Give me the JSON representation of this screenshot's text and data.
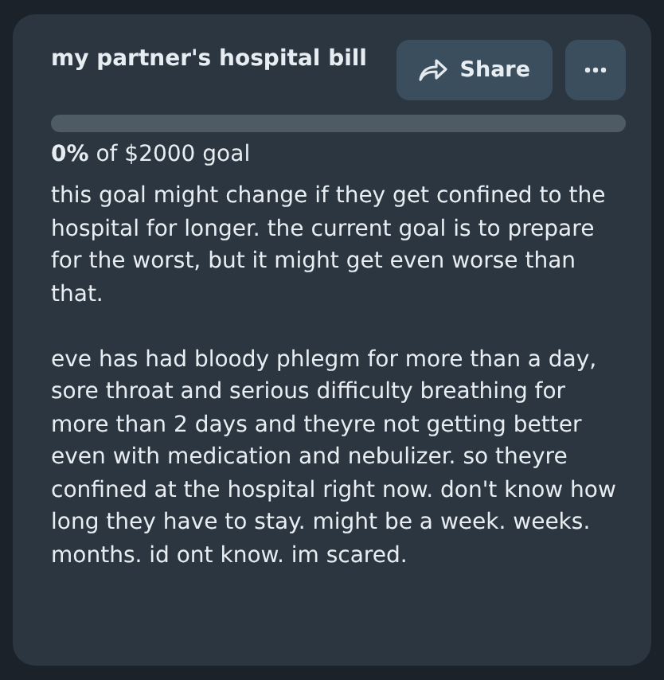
{
  "title": "my partner's hospital bill",
  "share_button": {
    "label": "Share"
  },
  "progress": {
    "level": 0,
    "caption": "**0%** of $2000 goal"
  },
  "description": [
    "this goal might change if they get confined to the hospital for longer. the current goal is to prepare for the worst, but it might get even worse than that.",
    "eve has had bloody phlegm for more than a day, sore throat and serious difficulty breathing for more than 2 days and theyre not getting better even with medication and nebulizer. so theyre confined at the hospital right now. don't know how long they have to stay. might be a week. weeks. months. id ont know. im scared."
  ]
}
